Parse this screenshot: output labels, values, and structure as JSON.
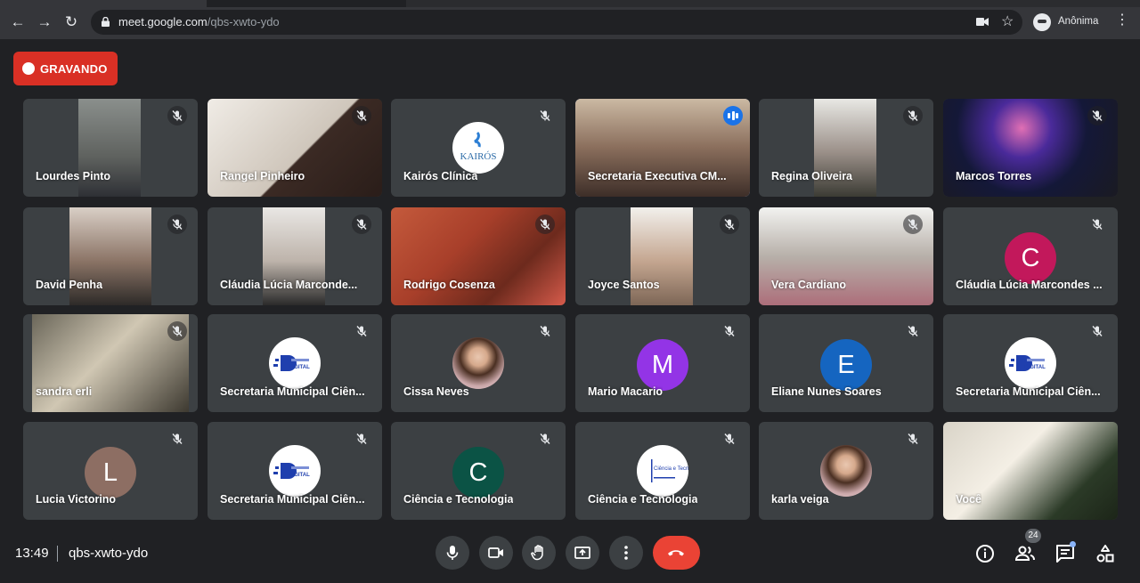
{
  "browser": {
    "url_domain": "meet.google.com",
    "url_path": "/qbs-xwto-ydo",
    "profile_label": "Anônima"
  },
  "recording": {
    "label": "GRAVANDO",
    "color": "#d93025"
  },
  "participants": [
    {
      "name": "Lourdes Pinto",
      "kind": "video",
      "muted": true
    },
    {
      "name": "Rangel Pinheiro",
      "kind": "video",
      "muted": true
    },
    {
      "name": "Kairós Clínica",
      "kind": "logo",
      "logo_text": "KAIRÓS",
      "muted": true
    },
    {
      "name": "Secretaria Executiva CM...",
      "kind": "video",
      "speaking": true
    },
    {
      "name": "Regina Oliveira",
      "kind": "video",
      "muted": true
    },
    {
      "name": "Marcos Torres",
      "kind": "video",
      "muted": true
    },
    {
      "name": "David Penha",
      "kind": "video",
      "muted": true
    },
    {
      "name": "Cláudia Lúcia Marconde...",
      "kind": "video",
      "muted": true
    },
    {
      "name": "Rodrigo Cosenza",
      "kind": "video",
      "muted": true
    },
    {
      "name": "Joyce Santos",
      "kind": "video",
      "muted": true
    },
    {
      "name": "Vera Cardiano",
      "kind": "video",
      "muted": true
    },
    {
      "name": "Cláudia Lúcia Marcondes ...",
      "kind": "initial",
      "initial": "C",
      "color": "#c2185b",
      "muted": true
    },
    {
      "name": "sandra erli",
      "kind": "video",
      "muted": true
    },
    {
      "name": "Secretaria Municipal Ciên...",
      "kind": "logo",
      "logo_text": "DIGITAL",
      "muted": true
    },
    {
      "name": "Cissa Neves",
      "kind": "photo",
      "muted": true
    },
    {
      "name": "Mario Macario",
      "kind": "initial",
      "initial": "M",
      "color": "#9334e6",
      "muted": true
    },
    {
      "name": "Eliane Nunes Soares",
      "kind": "initial",
      "initial": "E",
      "color": "#1565c0",
      "muted": true
    },
    {
      "name": "Secretaria Municipal Ciên...",
      "kind": "logo",
      "logo_text": "DIGITAL",
      "muted": true
    },
    {
      "name": "Lucia Victorino",
      "kind": "initial",
      "initial": "L",
      "color": "#8d6e63",
      "muted": true
    },
    {
      "name": "Secretaria Municipal Ciên...",
      "kind": "logo",
      "logo_text": "DIGITAL",
      "muted": true
    },
    {
      "name": "Ciência e Tecnologia",
      "kind": "initial",
      "initial": "C",
      "color": "#0b5345",
      "muted": true
    },
    {
      "name": "Ciência e Tecnologia",
      "kind": "logo",
      "logo_text": "Ciência e Tecnologia",
      "muted": true
    },
    {
      "name": "karla veiga",
      "kind": "photo",
      "muted": true
    },
    {
      "name": "Você",
      "kind": "video",
      "muted": false
    }
  ],
  "footer": {
    "time": "13:49",
    "meeting_code": "qbs-xwto-ydo",
    "participant_count": "24"
  },
  "icons": [
    "arrow-left-icon",
    "arrow-right-icon",
    "reload-icon",
    "lock-icon",
    "camera-icon",
    "star-icon",
    "incognito-icon",
    "more-vert-icon",
    "mic-off-icon",
    "mic-icon",
    "videocam-icon",
    "hand-icon",
    "present-icon",
    "end-call-icon",
    "info-icon",
    "people-icon",
    "chat-icon",
    "activities-icon"
  ]
}
